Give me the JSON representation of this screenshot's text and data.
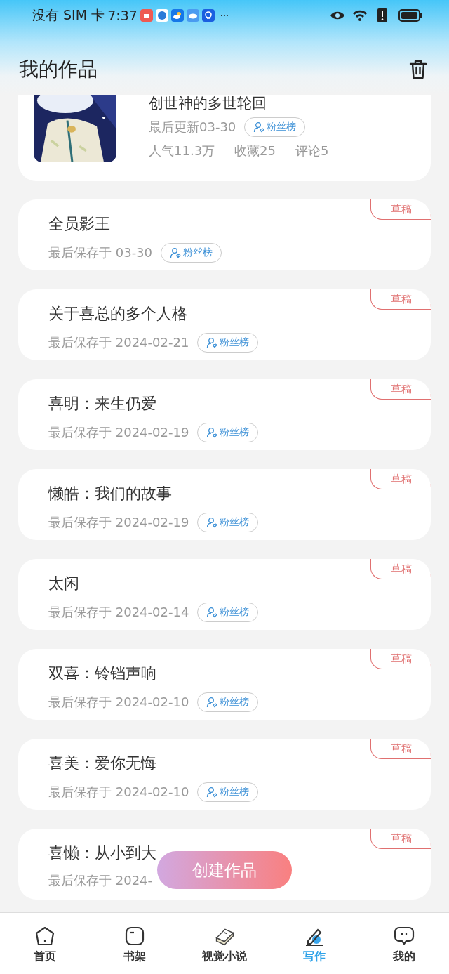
{
  "status_bar": {
    "carrier": "没有 SIM 卡",
    "time": "7:37",
    "more": "···"
  },
  "header": {
    "title": "我的作品"
  },
  "published": {
    "kind": "picture",
    "title": "创世神的多世轮回",
    "updated": "最后更新03-30",
    "fans_label": "粉丝榜",
    "popularity": "人气11.3万",
    "favorites": "收藏25",
    "comments": "评论5"
  },
  "drafts": [
    {
      "title": "全员影王",
      "saved": "最后保存于 03-30",
      "fans_label": "粉丝榜",
      "tag": "草稿"
    },
    {
      "title": "关于喜总的多个人格",
      "saved": "最后保存于 2024-02-21",
      "fans_label": "粉丝榜",
      "tag": "草稿"
    },
    {
      "title": "喜明：来生仍爱",
      "saved": "最后保存于 2024-02-19",
      "fans_label": "粉丝榜",
      "tag": "草稿"
    },
    {
      "title": "懒皓：我们的故事",
      "saved": "最后保存于 2024-02-19",
      "fans_label": "粉丝榜",
      "tag": "草稿"
    },
    {
      "title": "太闲",
      "saved": "最后保存于 2024-02-14",
      "fans_label": "粉丝榜",
      "tag": "草稿"
    },
    {
      "title": "双喜：铃铛声响",
      "saved": "最后保存于 2024-02-10",
      "fans_label": "粉丝榜",
      "tag": "草稿"
    },
    {
      "title": "喜美：爱你无悔",
      "saved": "最后保存于 2024-02-10",
      "fans_label": "粉丝榜",
      "tag": "草稿"
    },
    {
      "title": "喜懒：从小到大",
      "saved": "最后保存于 2024-",
      "tag": "草稿"
    }
  ],
  "create_button": "创建作品",
  "tabs": [
    {
      "label": "首页",
      "selected": false
    },
    {
      "label": "书架",
      "selected": false
    },
    {
      "label": "视觉小说",
      "selected": false
    },
    {
      "label": "写作",
      "selected": true
    },
    {
      "label": "我的",
      "selected": false
    }
  ]
}
